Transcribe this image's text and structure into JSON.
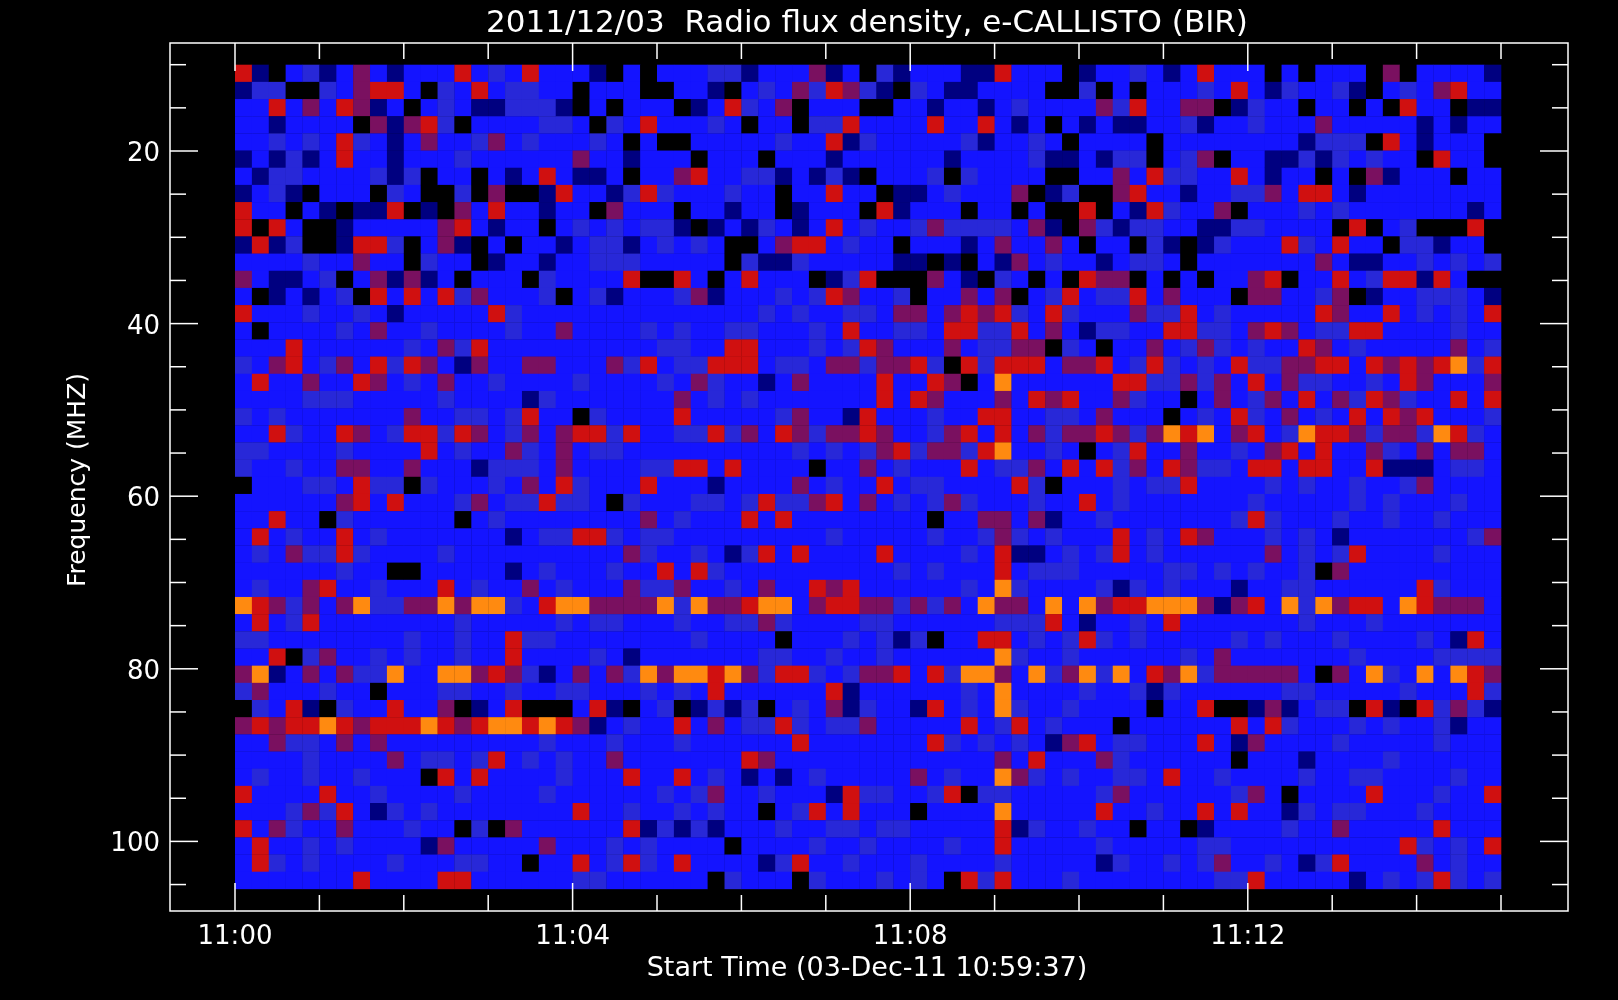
{
  "title": "2011/12/03  Radio flux density, e-CALLISTO (BIR)",
  "y_axis": {
    "label": "Frequency (MHZ)",
    "ticks": [
      "20",
      "40",
      "60",
      "80",
      "100"
    ]
  },
  "x_axis": {
    "label": "Start Time (03-Dec-11 10:59:37)",
    "ticks": [
      "11:00",
      "11:04",
      "11:08",
      "11:12"
    ]
  }
}
